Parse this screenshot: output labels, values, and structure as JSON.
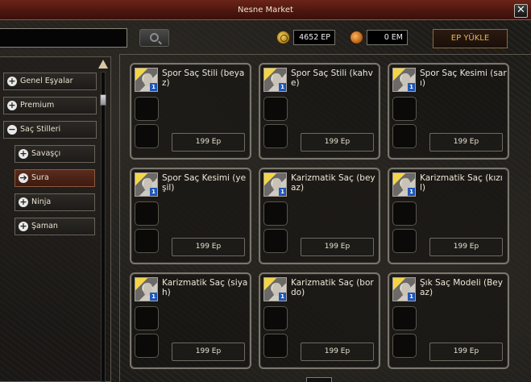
{
  "window": {
    "title": "Nesne Market"
  },
  "toolbar": {
    "search_value": "",
    "ep_amount": "4652 EP",
    "em_amount": "0 EM",
    "load_button": "EP YÜKLE"
  },
  "sidebar": {
    "items": [
      {
        "label": "Genel Eşyalar",
        "icon": "plus"
      },
      {
        "label": "Premium",
        "icon": "plus"
      },
      {
        "label": "Saç Stilleri",
        "icon": "minus"
      },
      {
        "label": "Savaşçı",
        "icon": "plus"
      },
      {
        "label": "Sura",
        "icon": "arrow",
        "active": true
      },
      {
        "label": "Ninja",
        "icon": "plus"
      },
      {
        "label": "Şaman",
        "icon": "plus"
      }
    ]
  },
  "products": [
    {
      "name": "Spor Saç Stili (beyaz)",
      "price": "199 Ep",
      "qty": "1"
    },
    {
      "name": "Spor Saç Stili (kahve)",
      "price": "199 Ep",
      "qty": "1"
    },
    {
      "name": "Spor Saç Kesimi (sarı)",
      "price": "199 Ep",
      "qty": "1"
    },
    {
      "name": "Spor Saç Kesimi (yeşil)",
      "price": "199 Ep",
      "qty": "1"
    },
    {
      "name": "Karizmatik Saç (beyaz)",
      "price": "199 Ep",
      "qty": "1"
    },
    {
      "name": "Karizmatik Saç (kızıl)",
      "price": "199 Ep",
      "qty": "1"
    },
    {
      "name": "Karizmatik Saç (siyah)",
      "price": "199 Ep",
      "qty": "1"
    },
    {
      "name": "Karizmatik Saç (bordo)",
      "price": "199 Ep",
      "qty": "1"
    },
    {
      "name": "Şık Saç Modeli (Beyaz)",
      "price": "199 Ep",
      "qty": "1"
    }
  ],
  "colors": {
    "title_bar": "#4e170f",
    "ep_yukle_text": "#e8b35a",
    "active_category": "#5a2c1d",
    "qty_badge": "#1f56b8"
  },
  "icons": {
    "close": "close-icon",
    "search": "search-icon",
    "ep_coin": "yang-coin-icon",
    "em_coin": "em-coin-icon"
  }
}
